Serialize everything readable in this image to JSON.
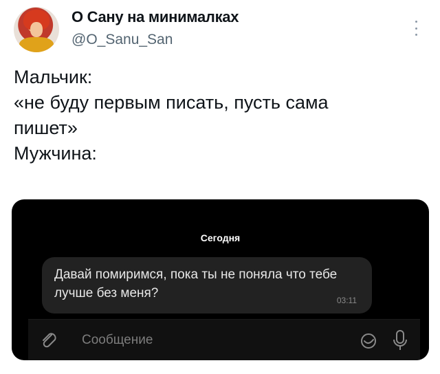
{
  "tweet": {
    "display_name": "О Сану на минималках",
    "handle": "@O_Sanu_San",
    "lines": [
      "Мальчик:",
      "«не буду первым писать, пусть сама",
      "пишет»",
      "Мужчина:"
    ]
  },
  "chat": {
    "date_label": "Сегодня",
    "message": {
      "text": "Давай помиримся, пока ты не поняла что тебе лучше без меня?",
      "time": "03:11"
    },
    "input": {
      "placeholder": "Сообщение"
    }
  }
}
